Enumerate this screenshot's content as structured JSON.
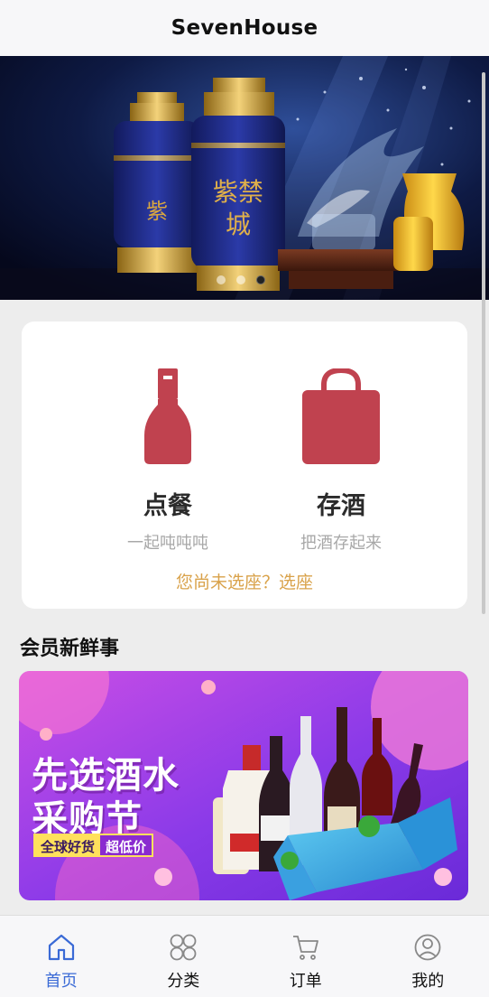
{
  "header": {
    "title": "SevenHouse"
  },
  "banner": {
    "dot_count": 3,
    "active_dot": 2
  },
  "services": [
    {
      "title": "点餐",
      "subtitle": "一起吨吨吨",
      "icon": "bottle-icon"
    },
    {
      "title": "存酒",
      "subtitle": "把酒存起来",
      "icon": "bag-icon"
    }
  ],
  "seat_prompt": "您尚未选座？选座",
  "section": {
    "title": "会员新鲜事"
  },
  "promo": {
    "line1": "先选酒水",
    "line2": "采购节",
    "tag1": "全球好货",
    "tag2": "超低价"
  },
  "tabbar": {
    "items": [
      {
        "label": "首页",
        "icon": "home-icon",
        "active": true
      },
      {
        "label": "分类",
        "icon": "category-icon",
        "active": false
      },
      {
        "label": "订单",
        "icon": "cart-icon",
        "active": false
      },
      {
        "label": "我的",
        "icon": "profile-icon",
        "active": false
      }
    ]
  },
  "colors": {
    "accent": "#3a6ad6",
    "icon_red": "#c0424f",
    "seat_text": "#d9a24a"
  }
}
